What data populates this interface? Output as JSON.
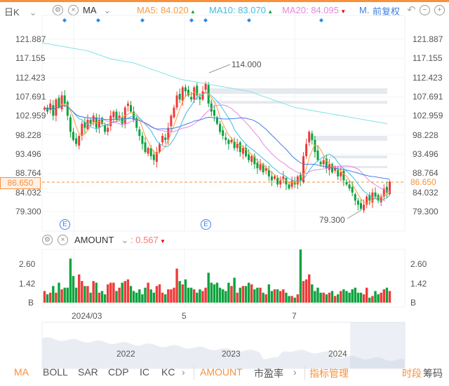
{
  "header": {
    "period": "日K",
    "indicator": "MA",
    "ma5_label": "MA5:",
    "ma5": "84.020",
    "ma10_label": "MA10:",
    "ma10": "83.070",
    "ma20_label": "MA20:",
    "ma20": "84.095",
    "more": "M.",
    "adjust": "前复权"
  },
  "colors": {
    "up": "#f03a3a",
    "down": "#0da33e",
    "ma5": "#ff9b3a",
    "ma10": "#3fbde6",
    "ma20": "#e886e0",
    "ma30": "#3f7fe6",
    "malong": "#7fe3e6",
    "accent": "#f7913b"
  },
  "price_axis": [
    "121.887",
    "117.155",
    "112.423",
    "107.691",
    "102.959",
    "98.228",
    "93.496",
    "88.764",
    "84.032",
    "79.300"
  ],
  "current_price": "86.650",
  "annotations": {
    "high": "114.000",
    "low": "79.300"
  },
  "volume": {
    "label": "AMOUNT",
    "value": ": 0.567",
    "axis": [
      "2.60",
      "1.42",
      "B"
    ]
  },
  "x_labels": [
    "2024/03",
    "5",
    "7"
  ],
  "navigator_labels": [
    "2022",
    "2023",
    "2024"
  ],
  "toolbar": {
    "items": [
      "MA",
      "BOLL",
      "SAR",
      "CDP",
      "IC",
      "KC"
    ],
    "amount": "AMOUNT",
    "pe": "市盈率",
    "manage": "指标管理",
    "period": "时段",
    "chips": "筹码"
  },
  "chart_data": {
    "type": "candlestick",
    "ylim": [
      79.3,
      121.887
    ],
    "closes": [
      105,
      104,
      106,
      103,
      107,
      105,
      108,
      106,
      103,
      99,
      97,
      96,
      98,
      101,
      100,
      102,
      101,
      103,
      100,
      102,
      101,
      99,
      100,
      103,
      104,
      102,
      103,
      101,
      105,
      106,
      104,
      102,
      100,
      98,
      96,
      94,
      95,
      93,
      92,
      94,
      96,
      98,
      97,
      100,
      103,
      105,
      108,
      107,
      110,
      109,
      108,
      107,
      110,
      108,
      107,
      109,
      111,
      106,
      104,
      103,
      101,
      99,
      98,
      97,
      96,
      97,
      95,
      96,
      94,
      95,
      93,
      92,
      93,
      91,
      90,
      91,
      89,
      90,
      88,
      87,
      88,
      86,
      87,
      88,
      86,
      85,
      87,
      86,
      88,
      87,
      93,
      96,
      99,
      97,
      94,
      92,
      91,
      92,
      90,
      91,
      89,
      90,
      88,
      89,
      87,
      86,
      85,
      84,
      82,
      81,
      80,
      81,
      83,
      82,
      84,
      83,
      82,
      83,
      85,
      84,
      86.65
    ],
    "volumes": [
      0.7,
      0.5,
      0.6,
      1.0,
      0.6,
      1.2,
      0.8,
      0.9,
      0.9,
      2.65,
      1.6,
      0.9,
      1.7,
      1.3,
      1.0,
      1.0,
      0.6,
      1.3,
      1.2,
      0.6,
      0.7,
      0.5,
      1.1,
      1.2,
      1.2,
      0.7,
      0.9,
      1.2,
      1.3,
      1.4,
      1.0,
      0.7,
      0.6,
      0.8,
      0.5,
      0.9,
      1.2,
      0.8,
      0.6,
      1.0,
      1.1,
      0.6,
      0.5,
      0.8,
      0.8,
      0.9,
      2.05,
      1.3,
      1.1,
      1.4,
      0.9,
      0.9,
      0.8,
      0.6,
      0.8,
      0.7,
      0.9,
      1.8,
      1.2,
      1.1,
      1.2,
      0.9,
      0.8,
      0.7,
      1.2,
      1.0,
      1.5,
      0.6,
      0.9,
      1.0,
      1.0,
      1.2,
      1.1,
      0.8,
      0.9,
      0.9,
      0.6,
      0.5,
      1.1,
      0.7,
      0.8,
      0.8,
      0.7,
      0.8,
      0.6,
      0.4,
      0.4,
      0.3,
      0.5,
      3.2,
      1.3,
      1.4,
      1.7,
      1.1,
      0.7,
      0.9,
      0.6,
      0.6,
      0.5,
      0.6,
      0.7,
      0.4,
      0.5,
      0.7,
      0.8,
      0.7,
      0.6,
      0.8,
      0.9,
      0.6,
      0.6,
      0.5,
      0.9,
      0.3,
      0.4,
      0.7,
      0.5,
      0.6,
      0.8,
      0.9,
      0.7
    ],
    "ma_long": [
      121,
      120,
      119,
      117,
      116,
      114,
      112,
      111,
      110,
      109,
      107,
      105,
      104,
      103,
      102,
      101
    ]
  }
}
